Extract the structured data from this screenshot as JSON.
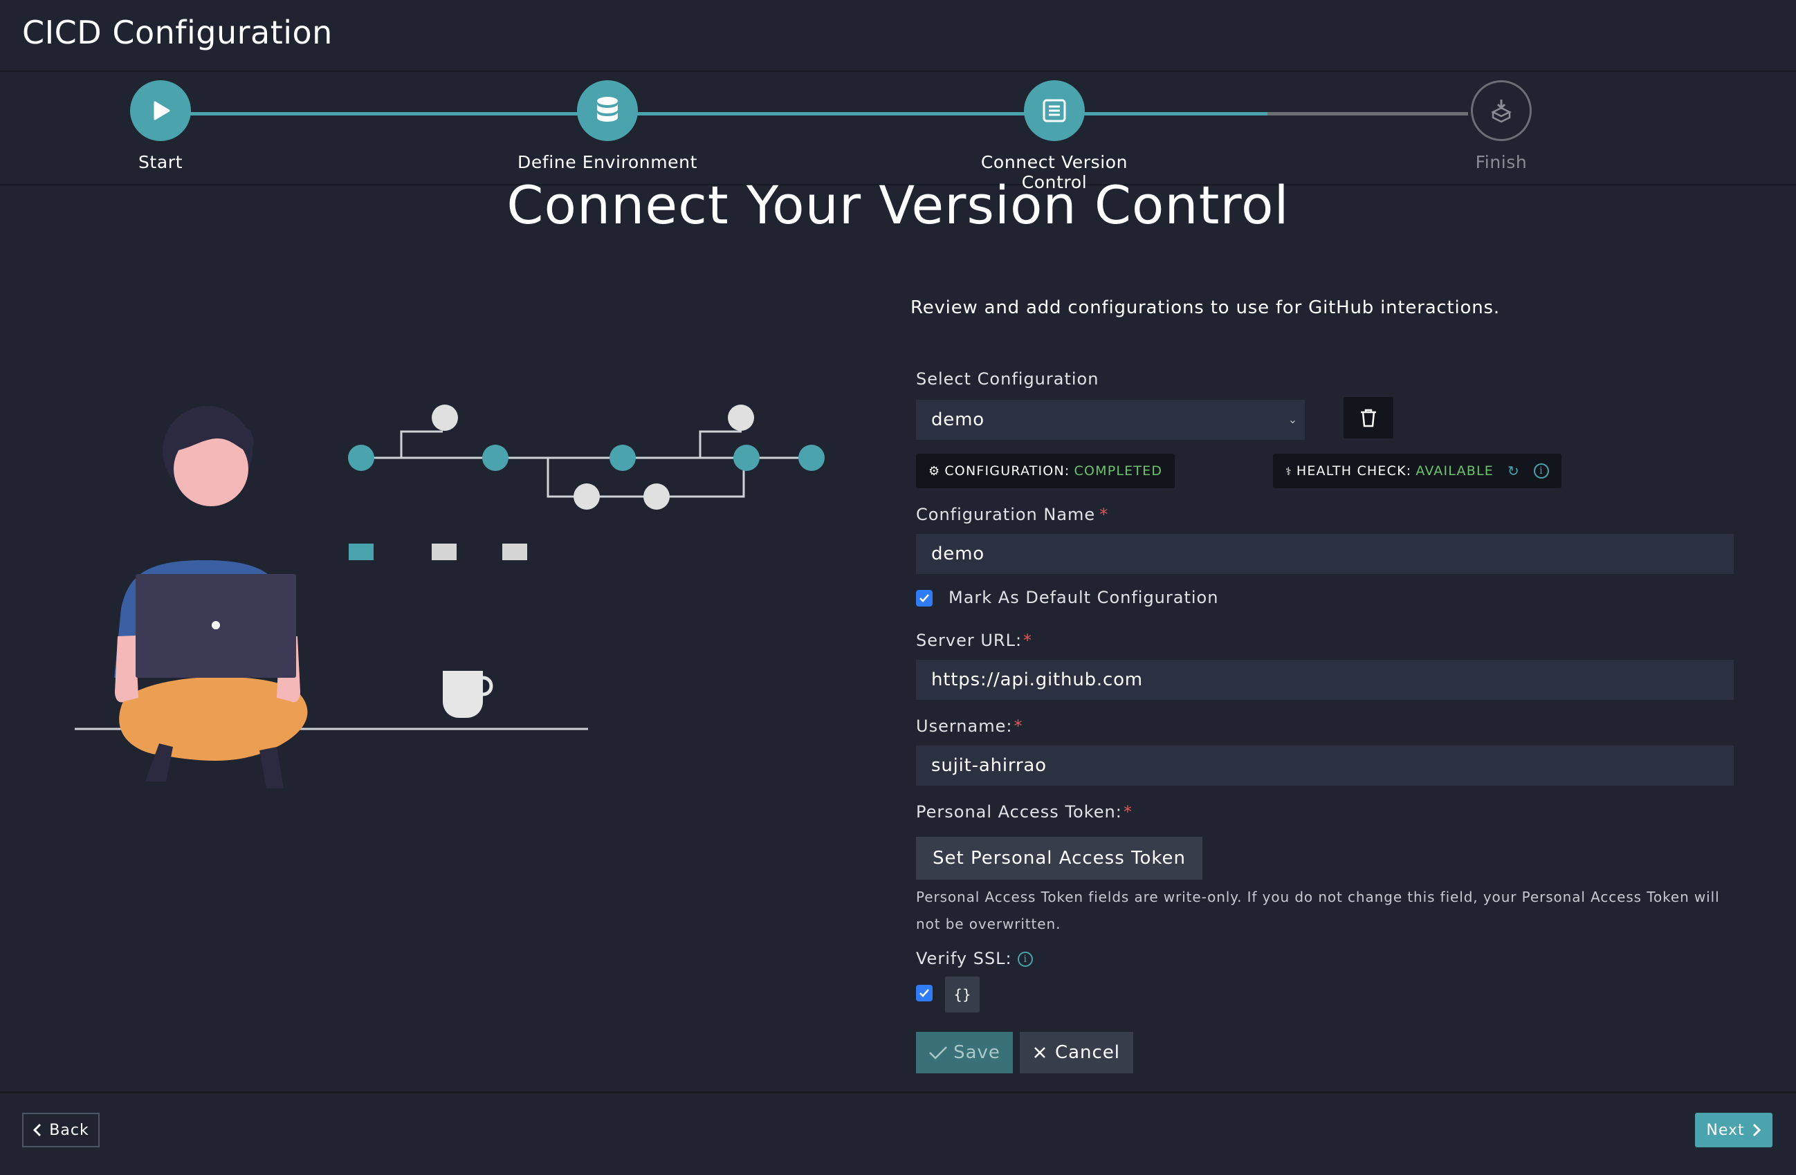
{
  "header": {
    "title": "CICD Configuration"
  },
  "stepper": {
    "steps": [
      {
        "label": "Start",
        "icon": "play-icon",
        "state": "done"
      },
      {
        "label": "Define Environment",
        "icon": "database-icon",
        "state": "done"
      },
      {
        "label": "Connect Version Control",
        "icon": "list-icon",
        "state": "current"
      },
      {
        "label": "Finish",
        "icon": "install-icon",
        "state": "todo"
      }
    ],
    "accent_color": "#4ba3ae"
  },
  "main": {
    "title": "Connect Your Version Control"
  },
  "form": {
    "intro": "Review and add configurations to use for GitHub interactions.",
    "select_label": "Select Configuration",
    "select_value": "demo",
    "status_badges": {
      "configuration_key": "CONFIGURATION:",
      "configuration_value": "COMPLETED",
      "health_key": "HEALTH CHECK:",
      "health_value": "AVAILABLE"
    },
    "config_name_label": "Configuration Name",
    "config_name_value": "demo",
    "default_label": "Mark As Default Configuration",
    "default_checked": true,
    "server_url_label": "Server URL:",
    "server_url_value": "https://api.github.com",
    "username_label": "Username:",
    "username_value": "sujit-ahirrao",
    "token_label": "Personal Access Token:",
    "token_button": "Set Personal Access Token",
    "token_help": "Personal Access Token fields are write-only. If you do not change this field, your Personal Access Token will not be overwritten.",
    "verify_ssl_label": "Verify SSL:",
    "verify_ssl_checked": true,
    "json_button": "{}",
    "save_label": "Save",
    "cancel_label": "Cancel",
    "required_mark": "*"
  },
  "footer": {
    "back_label": "Back",
    "next_label": "Next"
  }
}
